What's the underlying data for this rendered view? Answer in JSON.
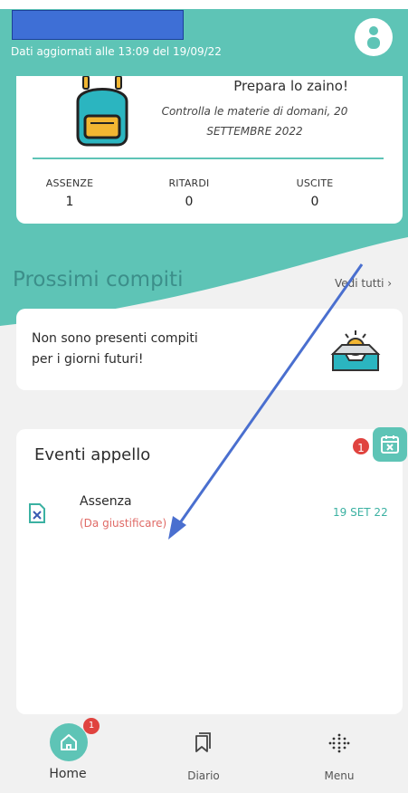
{
  "header": {
    "update_text": "Dati aggiornati alle 13:09 del 19/09/22",
    "avatar_icon": "user-icon"
  },
  "summary": {
    "title": "Prepara lo zaino!",
    "subtitle_line1": "Controlla le materie di  domani, 20",
    "subtitle_line2": "SETTEMBRE 2022",
    "stats": [
      {
        "label": "ASSENZE",
        "value": "1"
      },
      {
        "label": "RITARDI",
        "value": "0"
      },
      {
        "label": "USCITE",
        "value": "0"
      }
    ]
  },
  "compiti": {
    "title": "Prossimi compiti",
    "link": "Vedi tutti ›",
    "empty_line1": "Non sono presenti compiti",
    "empty_line2": "per i giorni futuri!"
  },
  "eventi": {
    "title": "Eventi appello",
    "badge_count": "1",
    "items": [
      {
        "name": "Assenza",
        "status": "(Da giustificare)",
        "date": "19 SET 22",
        "icon": "absence-icon"
      }
    ]
  },
  "nav": {
    "items": [
      {
        "label": "Home",
        "icon": "home-icon",
        "badge": "1"
      },
      {
        "label": "Diario",
        "icon": "bookmark-icon"
      },
      {
        "label": "Menu",
        "icon": "grid-icon"
      }
    ]
  },
  "colors": {
    "accent": "#5ec4b6",
    "alert": "#e0433f",
    "status_text": "#e06a66",
    "annotation_arrow": "#4a6fcf"
  }
}
